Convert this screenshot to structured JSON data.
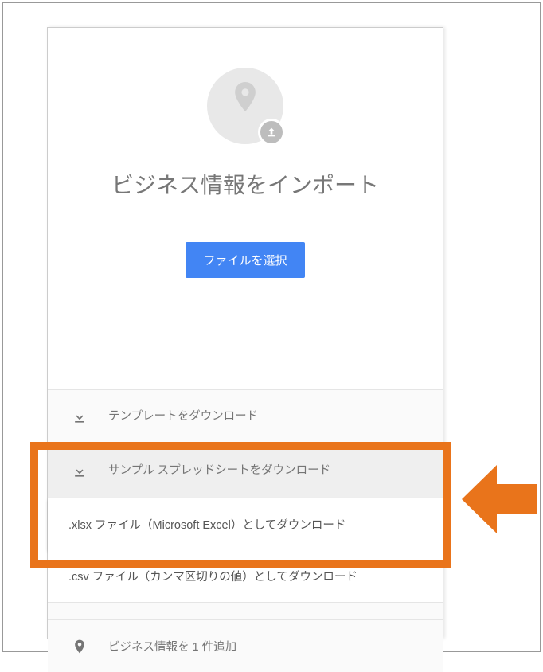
{
  "title": "ビジネス情報をインポート",
  "select_button": "ファイルを選択",
  "rows": {
    "template": "テンプレートをダウンロード",
    "sample": "サンプル スプレッドシートをダウンロード"
  },
  "options": {
    "xlsx": ".xlsx ファイル（Microsoft Excel）としてダウンロード",
    "csv": ".csv ファイル（カンマ区切りの値）としてダウンロード"
  },
  "add_one": "ビジネス情報を 1 件追加"
}
